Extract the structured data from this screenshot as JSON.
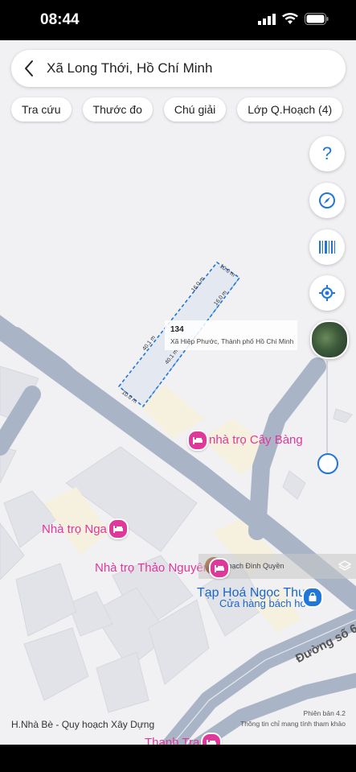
{
  "status_bar": {
    "time": "08:44"
  },
  "search": {
    "title": "Xã Long Thới, Hồ Chí Minh"
  },
  "chips": [
    "Tra cứu",
    "Thước đo",
    "Chú giải",
    "Lớp Q.Hoạch (4)"
  ],
  "fabs": {
    "help": "?"
  },
  "parcel": {
    "number": "134",
    "address": "Xã Hiệp Phước, Thành phố Hồ Chí Minh",
    "dim_top": "16.0 m",
    "dim_right_short": "10.0 m",
    "dim_right_long": "16.0 m",
    "dim_left": "40.1 m",
    "dim_inner": "40.1 m",
    "dim_bottom": "10.0 m"
  },
  "pois": {
    "cay_bang": "nhà trọ Cây Bàng",
    "nga": "Nhà trọ Nga",
    "thao_nguyen": "Nhà trọ Thảo Nguyên",
    "thanh_tra": "Thanh Tra"
  },
  "shop": {
    "name": "Tạp Hoá Ngọc Thuý",
    "category": "Cửa hàng bách hóa"
  },
  "user": {
    "name": "Thạch Đình Quyền"
  },
  "street": "Đường số 6",
  "footer": {
    "left": "H.Nhà Bè - Quy hoạch Xây Dựng",
    "version": "Phiên bản 4.2",
    "disclaimer": "Thông tin chỉ mang tính tham khảo"
  },
  "colors": {
    "accent": "#2176d9",
    "poi": "#e0389a",
    "road": "#a9b5c7"
  }
}
